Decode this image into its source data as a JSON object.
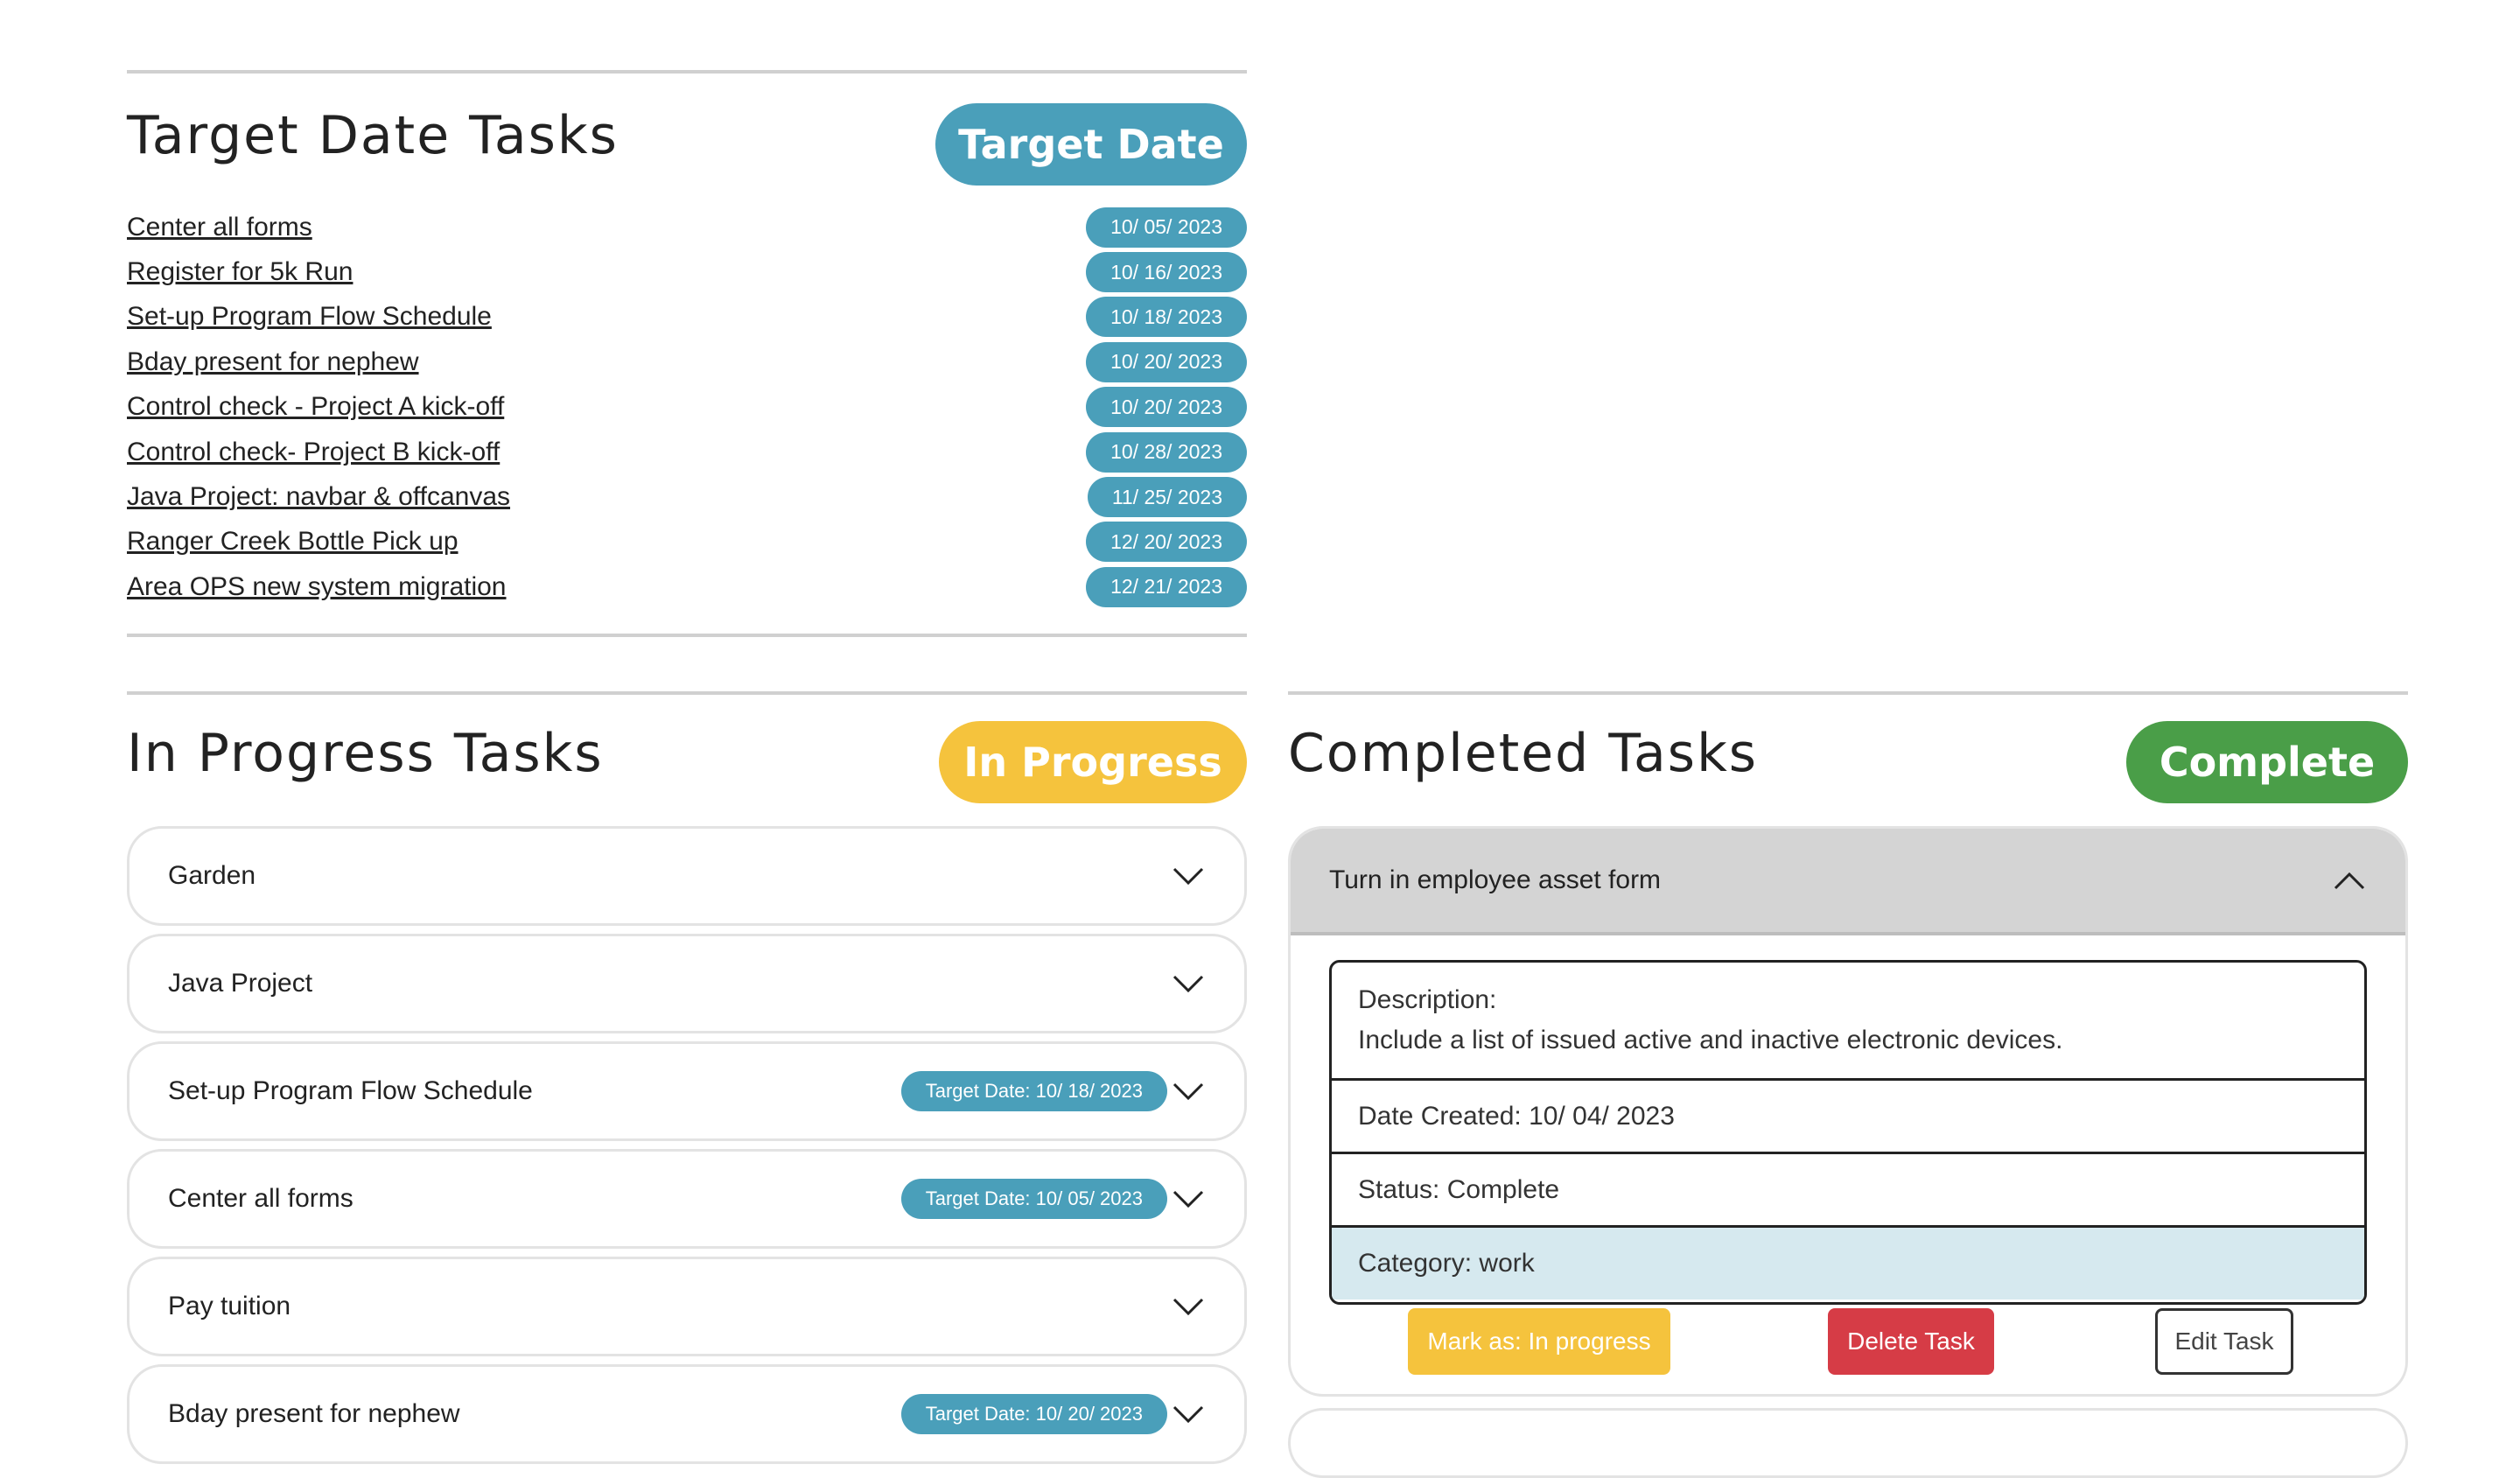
{
  "target_section": {
    "title": "Target Date Tasks",
    "button_label": "Target Date",
    "tasks": [
      {
        "name": "Center all forms",
        "date": "10/ 05/ 2023"
      },
      {
        "name": "Register for 5k Run",
        "date": "10/ 16/ 2023"
      },
      {
        "name": "Set-up Program Flow Schedule",
        "date": "10/ 18/ 2023"
      },
      {
        "name": "Bday present for nephew",
        "date": "10/ 20/ 2023"
      },
      {
        "name": "Control check - Project A kick-off",
        "date": "10/ 20/ 2023"
      },
      {
        "name": "Control check- Project B kick-off",
        "date": "10/ 28/ 2023"
      },
      {
        "name": "Java Project: navbar & offcanvas",
        "date": "11/ 25/ 2023"
      },
      {
        "name": "Ranger Creek Bottle Pick up",
        "date": "12/ 20/ 2023"
      },
      {
        "name": "Area OPS new system migration",
        "date": "12/ 21/ 2023"
      }
    ]
  },
  "progress_section": {
    "title": "In Progress Tasks",
    "button_label": "In Progress",
    "items": [
      {
        "label": "Garden",
        "badge": ""
      },
      {
        "label": "Java Project",
        "badge": ""
      },
      {
        "label": "Set-up Program Flow Schedule",
        "badge": "Target Date: 10/ 18/ 2023"
      },
      {
        "label": "Center all forms",
        "badge": "Target Date: 10/ 05/ 2023"
      },
      {
        "label": "Pay tuition",
        "badge": ""
      },
      {
        "label": "Bday present for nephew",
        "badge": "Target Date: 10/ 20/ 2023"
      }
    ]
  },
  "complete_section": {
    "title": "Completed Tasks",
    "button_label": "Complete",
    "expanded_item": {
      "label": "Turn in employee asset form",
      "description_label": "Description:",
      "description": "Include a list of issued active and inactive electronic devices.",
      "date_created": "Date Created: 10/ 04/ 2023",
      "status": "Status: Complete",
      "category": "Category: work",
      "mark_button": "Mark as: In progress",
      "delete_button": "Delete Task",
      "edit_button": "Edit Task"
    }
  },
  "colors": {
    "target": "#4a9fba",
    "progress": "#f5c33d",
    "complete": "#4a9e48",
    "delete": "#d63c46",
    "category_bg": "#d6e9ef"
  },
  "icons": {
    "collapsed": "chevron-down-icon",
    "expanded": "chevron-up-icon"
  }
}
